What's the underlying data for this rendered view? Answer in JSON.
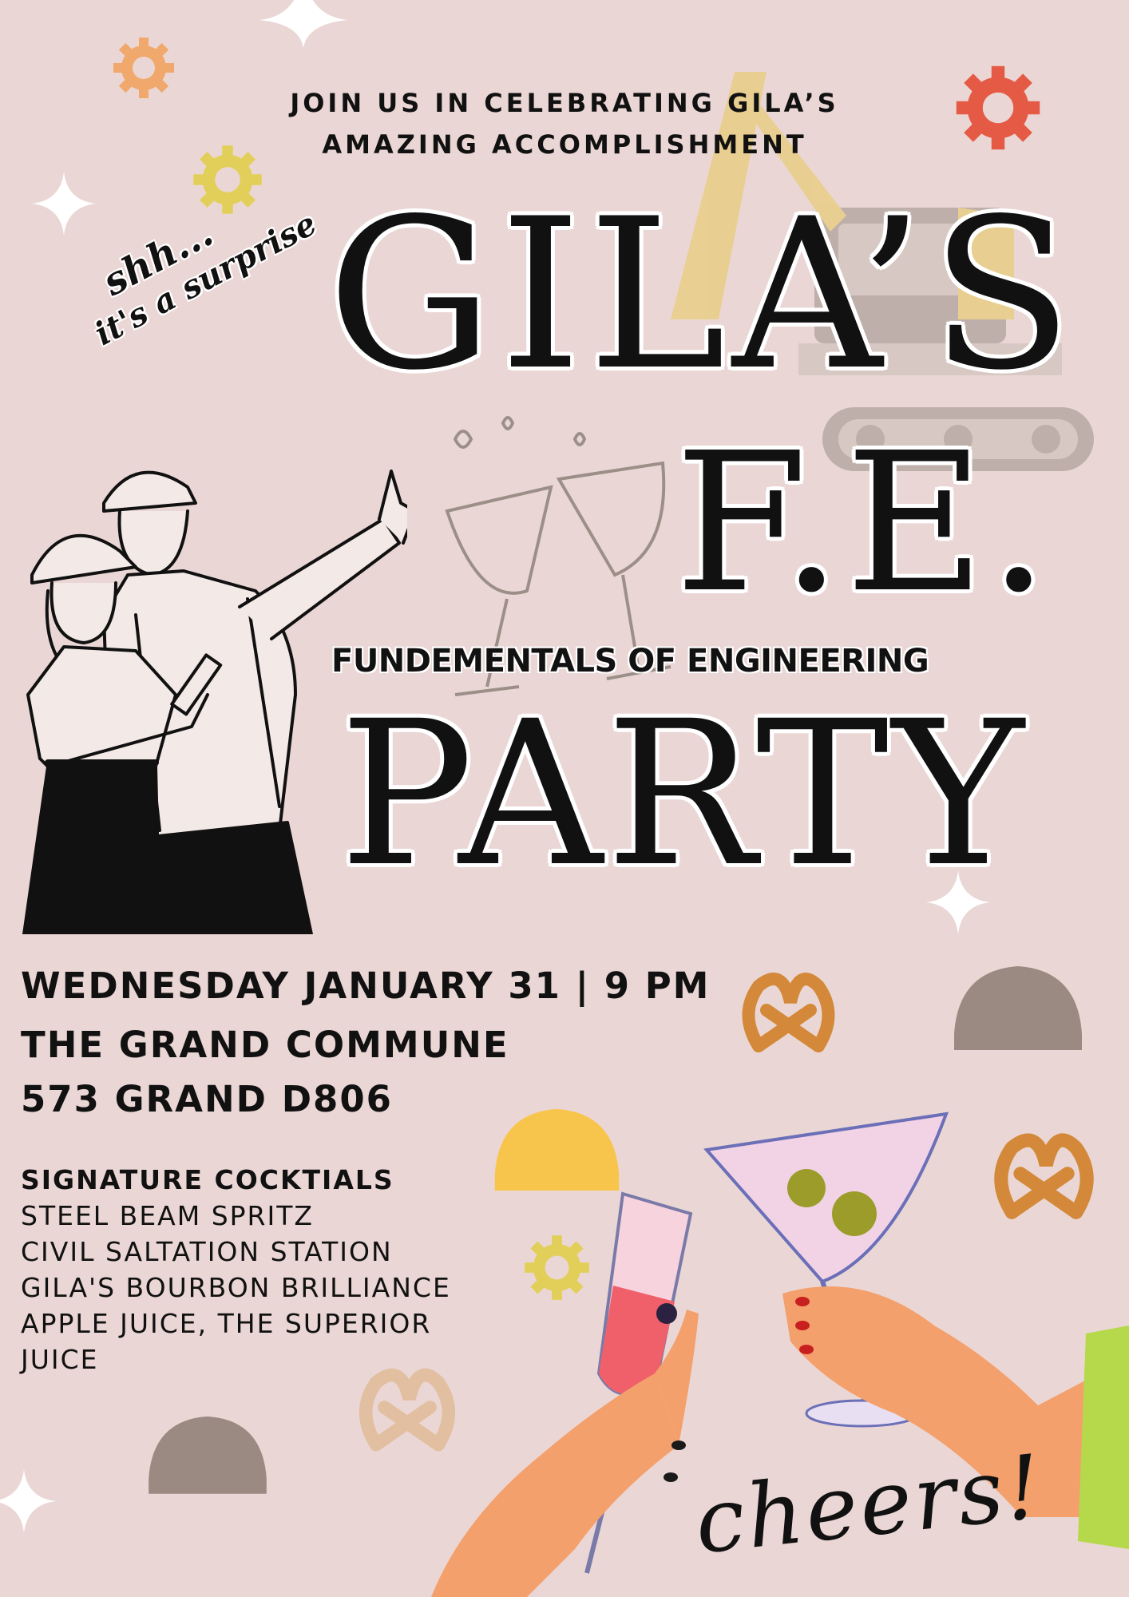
{
  "header": {
    "line1": "JOIN US IN CELEBRATING GILA’S",
    "line2": "AMAZING ACCOMPLISHMENT"
  },
  "tagline": {
    "line1": "shh...",
    "line2": "it's a surprise"
  },
  "title": {
    "name": "GILA’S",
    "exam": "F.E.",
    "subtitle": "FUNDEMENTALS OF ENGINEERING",
    "party": "PARTY"
  },
  "event": {
    "datetime": "WEDNESDAY JANUARY 31 | 9 PM",
    "venue": "THE GRAND COMMUNE",
    "address": "573 GRAND D806"
  },
  "menu": {
    "heading": "SIGNATURE COCKTIALS",
    "items": [
      "STEEL BEAM SPRITZ",
      "CIVIL SALTATION STATION",
      "GILA'S BOURBON BRILLIANCE",
      "APPLE JUICE, THE SUPERIOR",
      "JUICE"
    ]
  },
  "closing": "cheers!",
  "colors": {
    "background": "#ead7d5",
    "gear_orange": "#f0a86c",
    "gear_red": "#e55a45",
    "gear_yellow": "#e2cf5a",
    "hard_hat_gray": "#9b8a82",
    "hard_hat_yellow": "#f8c54c",
    "pretzel": "#d4893a",
    "excavator": "#e8c95a"
  }
}
